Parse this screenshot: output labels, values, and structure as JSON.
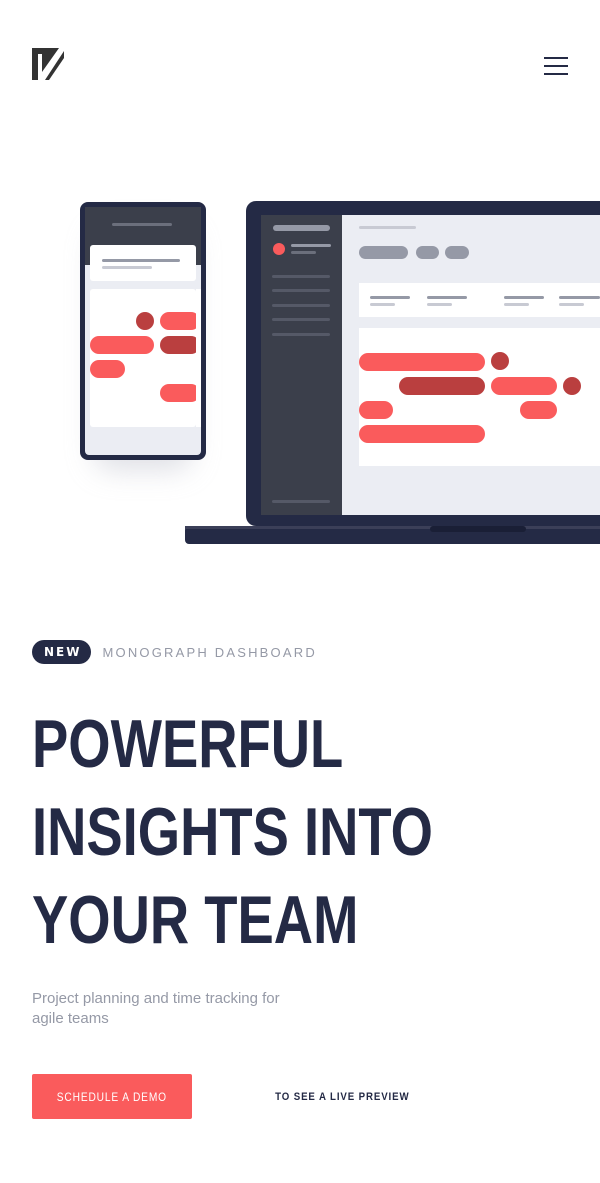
{
  "header": {
    "logo_icon": "logo-k-icon",
    "menu_icon": "hamburger-menu-icon"
  },
  "hero": {
    "badge": "NEW",
    "tagline": "MONOGRAPH DASHBOARD",
    "headline_lines": [
      "POWERFUL",
      "INSIGHTS INTO",
      "YOUR TEAM"
    ],
    "subtitle": "Project planning and time tracking for agile teams",
    "primary_cta": "SCHEDULE A DEMO",
    "secondary_cta": "TO SEE A LIVE PREVIEW"
  },
  "colors": {
    "navy": "#242a45",
    "accent": "#fa5b5c",
    "accent_dark": "#ba3f3f",
    "muted": "#9599a6",
    "panel_bg": "#ebedf3"
  }
}
